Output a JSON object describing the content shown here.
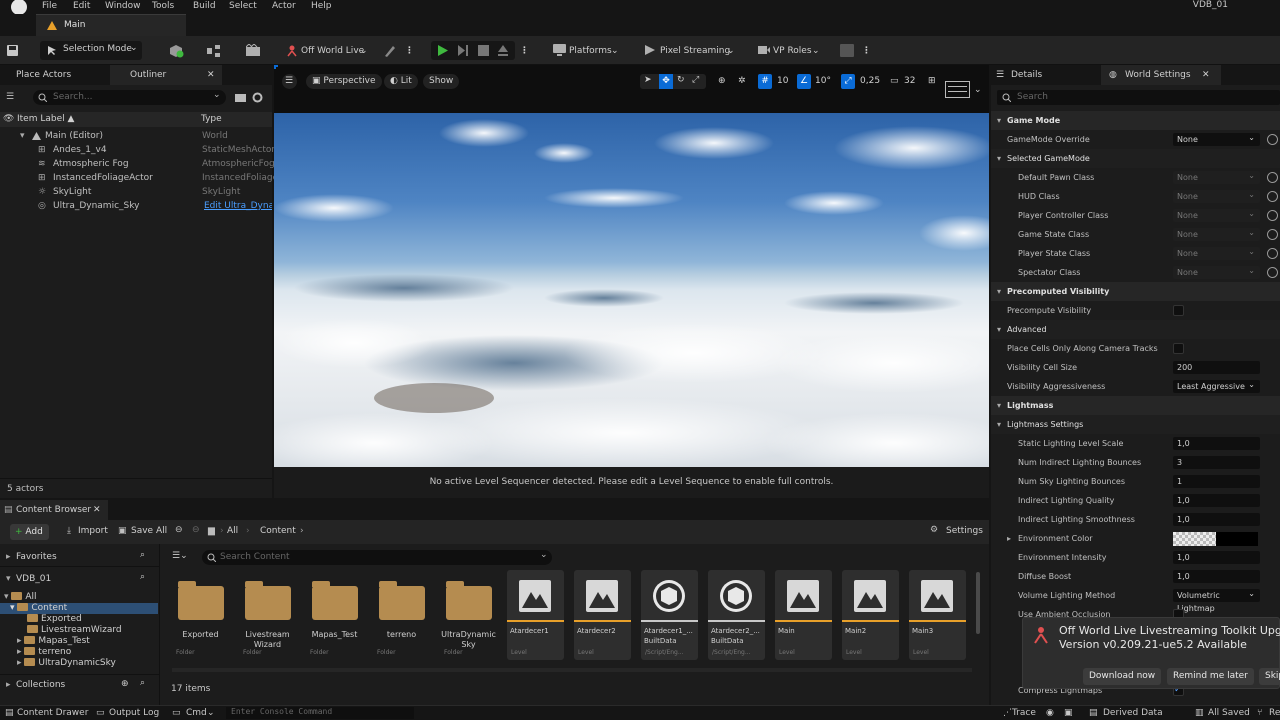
{
  "menubar": {
    "items": [
      "File",
      "Edit",
      "Window",
      "Tools",
      "Build",
      "Select",
      "Actor",
      "Help"
    ],
    "project": "VDB_01"
  },
  "level_tab": "Main",
  "toolbar": {
    "mode": "Selection Mode",
    "world": "Off World Live",
    "platforms": "Platforms",
    "pixel_streaming": "Pixel Streaming",
    "vp_roles": "VP Roles"
  },
  "outliner": {
    "tab_place": "Place Actors",
    "tab_outliner": "Outliner",
    "search_placeholder": "Search...",
    "col_label": "Item Label ▲",
    "col_type": "Type",
    "rows": [
      {
        "label": "Main (Editor)",
        "type": "World"
      },
      {
        "label": "Andes_1_v4",
        "type": "StaticMeshActor"
      },
      {
        "label": "Atmospheric Fog",
        "type": "AtmosphericFog"
      },
      {
        "label": "InstancedFoliageActor",
        "type": "InstancedFoliage"
      },
      {
        "label": "SkyLight",
        "type": "SkyLight"
      },
      {
        "label": "Ultra_Dynamic_Sky",
        "type": "Edit Ultra_Dynan"
      }
    ],
    "count": "5 actors"
  },
  "viewport": {
    "perspective": "Perspective",
    "lit": "Lit",
    "show": "Show",
    "grid": "10",
    "angle": "10°",
    "scale": "0,25",
    "cam_speed": "32",
    "message": "No active Level Sequencer detected. Please edit a Level Sequence to enable full controls."
  },
  "details": {
    "tab_details": "Details",
    "tab_world": "World Settings",
    "search_placeholder": "Search",
    "rows": [
      {
        "kind": "section",
        "label": "Game Mode"
      },
      {
        "kind": "select",
        "label": "GameMode Override",
        "value": "None",
        "indent": 0
      },
      {
        "kind": "section2",
        "label": "Selected GameMode"
      },
      {
        "kind": "select",
        "label": "Default Pawn Class",
        "value": "None",
        "indent": 1,
        "dim": true
      },
      {
        "kind": "select",
        "label": "HUD Class",
        "value": "None",
        "indent": 1,
        "dim": true
      },
      {
        "kind": "select",
        "label": "Player Controller Class",
        "value": "None",
        "indent": 1,
        "dim": true
      },
      {
        "kind": "select",
        "label": "Game State Class",
        "value": "None",
        "indent": 1,
        "dim": true
      },
      {
        "kind": "select",
        "label": "Player State Class",
        "value": "None",
        "indent": 1,
        "dim": true
      },
      {
        "kind": "select",
        "label": "Spectator Class",
        "value": "None",
        "indent": 1,
        "dim": true
      },
      {
        "kind": "section",
        "label": "Precomputed Visibility"
      },
      {
        "kind": "check",
        "label": "Precompute Visibility",
        "indent": 0
      },
      {
        "kind": "section2",
        "label": "Advanced"
      },
      {
        "kind": "check",
        "label": "Place Cells Only Along Camera Tracks",
        "indent": 0
      },
      {
        "kind": "input",
        "label": "Visibility Cell Size",
        "value": "200",
        "indent": 0
      },
      {
        "kind": "select",
        "label": "Visibility Aggressiveness",
        "value": "Least Aggressive",
        "indent": 0
      },
      {
        "kind": "section",
        "label": "Lightmass"
      },
      {
        "kind": "section2",
        "label": "Lightmass Settings"
      },
      {
        "kind": "input",
        "label": "Static Lighting Level Scale",
        "value": "1,0",
        "indent": 1
      },
      {
        "kind": "input",
        "label": "Num Indirect Lighting Bounces",
        "value": "3",
        "indent": 1
      },
      {
        "kind": "input",
        "label": "Num Sky Lighting Bounces",
        "value": "1",
        "indent": 1
      },
      {
        "kind": "input",
        "label": "Indirect Lighting Quality",
        "value": "1,0",
        "indent": 1
      },
      {
        "kind": "input",
        "label": "Indirect Lighting Smoothness",
        "value": "1,0",
        "indent": 1
      },
      {
        "kind": "color",
        "label": "Environment Color",
        "indent": 1
      },
      {
        "kind": "input",
        "label": "Environment Intensity",
        "value": "1,0",
        "indent": 1
      },
      {
        "kind": "input",
        "label": "Diffuse Boost",
        "value": "1,0",
        "indent": 1
      },
      {
        "kind": "select",
        "label": "Volume Lighting Method",
        "value": "Volumetric Lightmap",
        "indent": 1
      },
      {
        "kind": "check",
        "label": "Use Ambient Occlusion",
        "indent": 1
      },
      {
        "kind": "check",
        "label": "",
        "indent": 1
      },
      {
        "kind": "check",
        "label": "",
        "indent": 1
      },
      {
        "kind": "check",
        "label": "",
        "indent": 1
      },
      {
        "kind": "check",
        "label": "Compress Lightmaps",
        "indent": 1
      }
    ]
  },
  "content_browser": {
    "tab": "Content Browser",
    "add": "Add",
    "import": "Import",
    "save_all": "Save All",
    "crumbs": [
      "All",
      "Content"
    ],
    "settings": "Settings",
    "favorites": "Favorites",
    "project": "VDB_01",
    "tree": [
      "All",
      "Content",
      "Exported",
      "LivestreamWizard",
      "Mapas_Test",
      "terreno",
      "UltraDynamicSky"
    ],
    "collections": "Collections",
    "search_placeholder": "Search Content",
    "items_count": "17 items",
    "tiles": [
      {
        "name": "Exported",
        "kind": "Folder",
        "type": "folder"
      },
      {
        "name": "Livestream Wizard",
        "kind": "Folder",
        "type": "folder"
      },
      {
        "name": "Mapas_Test",
        "kind": "Folder",
        "type": "folder"
      },
      {
        "name": "terreno",
        "kind": "Folder",
        "type": "folder"
      },
      {
        "name": "UltraDynamic Sky",
        "kind": "Folder",
        "type": "folder"
      },
      {
        "name": "Atardecer1",
        "kind": "Level",
        "type": "level"
      },
      {
        "name": "Atardecer2",
        "kind": "Level",
        "type": "level"
      },
      {
        "name": "Atardecer1_... BuiltData",
        "kind": "/Script/Eng...",
        "type": "data"
      },
      {
        "name": "Atardecer2_... BuiltData",
        "kind": "/Script/Eng...",
        "type": "data"
      },
      {
        "name": "Main",
        "kind": "Level",
        "type": "level"
      },
      {
        "name": "Main2",
        "kind": "Level",
        "type": "level"
      },
      {
        "name": "Main3",
        "kind": "Level",
        "type": "level"
      }
    ]
  },
  "statusbar": {
    "content_drawer": "Content Drawer",
    "output_log": "Output Log",
    "cmd": "Cmd",
    "console_placeholder": "Enter Console Command",
    "trace": "Trace",
    "derived": "Derived Data",
    "saved": "All Saved",
    "rev": "Re"
  },
  "toast": {
    "title": "Off World Live Livestreaming Toolkit Upgrade",
    "version": "Version v0.209.21-ue5.2 Available",
    "download": "Download now",
    "remind": "Remind me later",
    "skip": "Skip"
  },
  "colors": {
    "accent": "#0a6bd6",
    "play": "#3fb93f",
    "level_bar": "#e8a02a",
    "folder": "#b58c50"
  }
}
